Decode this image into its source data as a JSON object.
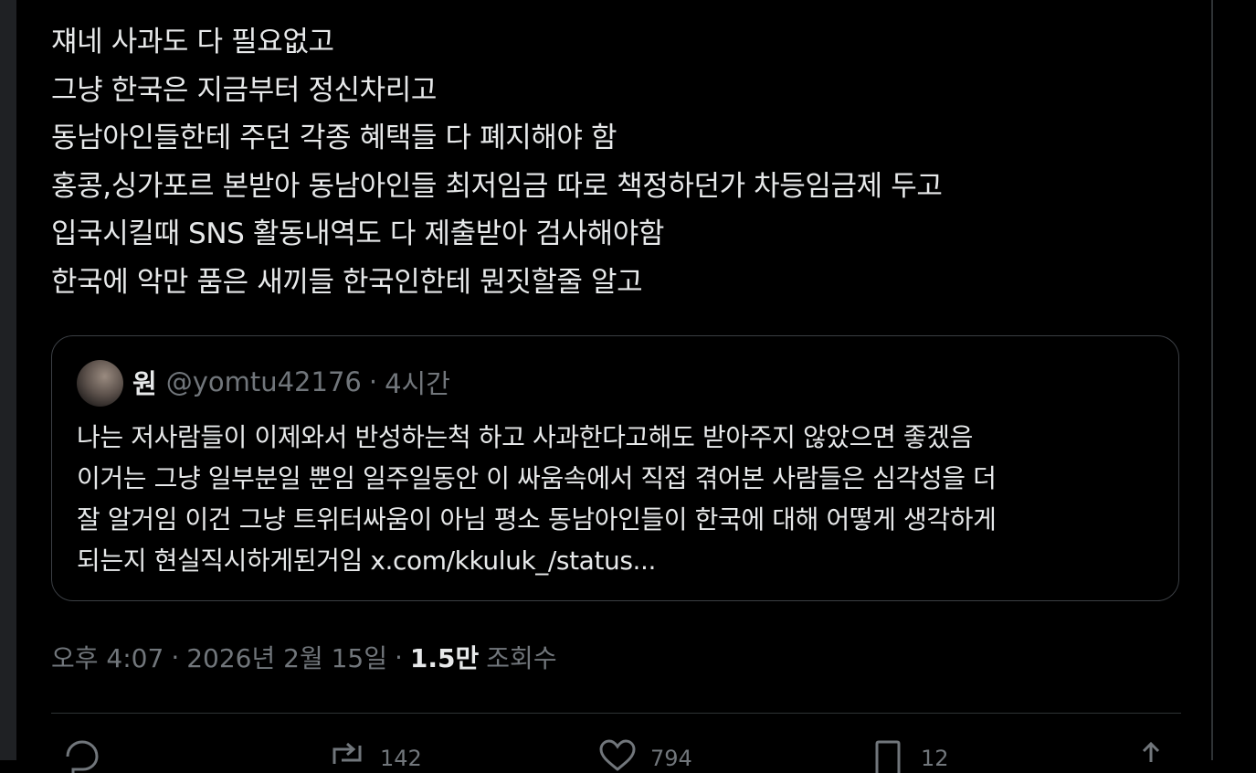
{
  "tweet": {
    "lines": [
      "쟤네 사과도 다 필요없고",
      "그냥 한국은 지금부터 정신차리고",
      "동남아인들한테 주던 각종 혜택들 다 폐지해야 함",
      "홍콩,싱가포르 본받아 동남아인들 최저임금 따로 책정하던가 차등임금제 두고",
      "입국시킬때 SNS 활동내역도 다 제출받아 검사해야함",
      "한국에 악만 품은 새끼들 한국인한테 뭔짓할줄 알고"
    ]
  },
  "quote": {
    "name": "원",
    "handle": "@yomtu42176",
    "separator": "·",
    "time": "4시간",
    "lines": [
      "나는 저사람들이 이제와서 반성하는척 하고 사과한다고해도 받아주지 않았으면 좋겠음",
      "이거는 그냥 일부분일 뿐임 일주일동안 이 싸움속에서 직접 겪어본 사람들은 심각성을 더",
      "잘 알거임 이건 그냥 트위터싸움이 아님 평소 동남아인들이 한국에 대해 어떻게 생각하게",
      "되는지 현실직시하게된거임 x.com/kkuluk_/status..."
    ]
  },
  "meta": {
    "time": "오후 4:07",
    "sep1": "·",
    "date": "2026년 2월 15일",
    "sep2": "·",
    "views_count": "1.5만",
    "views_label": "조회수"
  },
  "actions": {
    "reply_count": "",
    "retweet_count": "142",
    "like_count": "794",
    "bookmark_count": "12",
    "icons": [
      "reply-icon",
      "retweet-icon",
      "like-icon",
      "bookmark-icon",
      "share-icon"
    ]
  },
  "colors": {
    "background": "#000000",
    "text": "#e7e9ea",
    "muted": "#71767b",
    "border": "#3b3f44"
  }
}
